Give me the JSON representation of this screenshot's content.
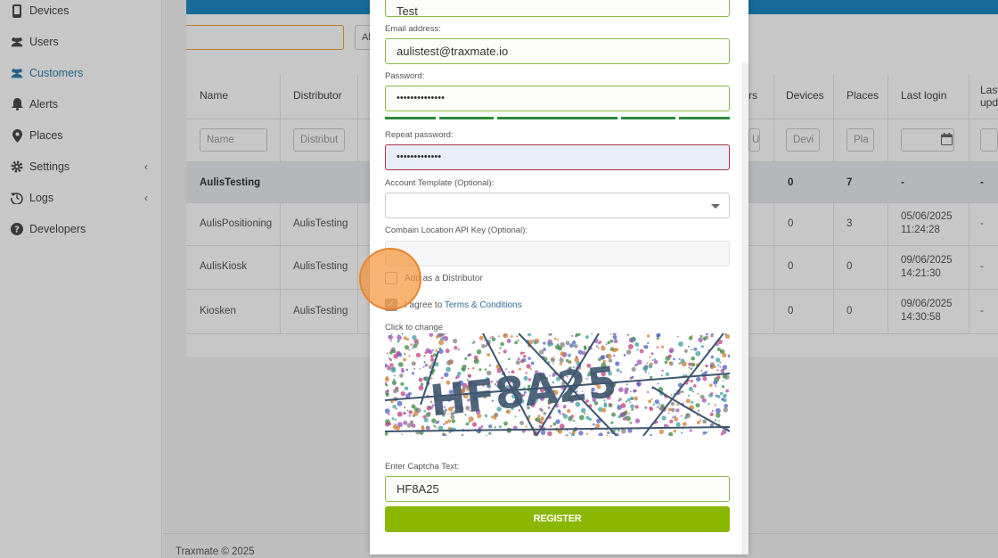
{
  "sidebar": {
    "items": [
      {
        "label": "Devices",
        "icon": "device-icon",
        "active": false
      },
      {
        "label": "Users",
        "icon": "users-icon",
        "active": false
      },
      {
        "label": "Customers",
        "icon": "customers-icon",
        "active": true
      },
      {
        "label": "Alerts",
        "icon": "bell-icon",
        "active": false
      },
      {
        "label": "Places",
        "icon": "map-pin-icon",
        "active": false
      },
      {
        "label": "Settings",
        "icon": "gear-icon",
        "active": false,
        "expandable": true
      },
      {
        "label": "Logs",
        "icon": "history-icon",
        "active": false,
        "expandable": true
      },
      {
        "label": "Developers",
        "icon": "question-icon",
        "active": false
      }
    ]
  },
  "toolbar": {
    "button_partial": "Al"
  },
  "table": {
    "headers": [
      "Name",
      "Distributor",
      "rs",
      "Devices",
      "Places",
      "Last login",
      "Last",
      "upd"
    ],
    "filters": {
      "name": "Name",
      "distributor": "Distribut",
      "users": "U",
      "devices": "Devi",
      "places": "Pla"
    },
    "rows": [
      {
        "name": "AulisTesting",
        "distributor": "",
        "devices": "0",
        "places": "7",
        "last_login": "-",
        "last_update": "-"
      },
      {
        "name": "AulisPositioning",
        "distributor": "AulisTesting",
        "devices": "0",
        "places": "3",
        "last_login": "05/06/2025",
        "last_login_time": "11:24:28",
        "last_update": "-"
      },
      {
        "name": "AulisKiosk",
        "distributor": "AulisTesting",
        "devices": "0",
        "places": "0",
        "last_login": "09/06/2025",
        "last_login_time": "14:21:30",
        "last_update": "-"
      },
      {
        "name": "Kiosken",
        "distributor": "AulisTesting",
        "devices": "0",
        "places": "0",
        "last_login": "09/06/2025",
        "last_login_time": "14:30:58",
        "last_update": "-"
      }
    ]
  },
  "footer": {
    "text": "Traxmate © 2025"
  },
  "modal": {
    "name_value": "Test",
    "email_label": "Email address:",
    "email_value": "aulistest@traxmate.io",
    "password_label": "Password:",
    "password_value": "••••••••••••••",
    "repeat_label": "Repeat password:",
    "repeat_value": "•••••••••••••",
    "template_label": "Account Template (Optional):",
    "template_value": "",
    "combain_label": "Combain Location API Key (Optional):",
    "combain_value": "",
    "distributor_label": "Add as a Distributor",
    "agree_prefix": "I agree to",
    "agree_link": "Terms & Conditions",
    "captcha_hint": "Click to change",
    "captcha_code": "HF8A25",
    "captcha_label": "Enter Captcha Text:",
    "captcha_value": "HF8A25",
    "register_label": "REGISTER"
  },
  "colors": {
    "accent": "#2e7fb0",
    "header_blue": "#1f88c4",
    "register_green": "#8ab800",
    "valid_border": "#8bb84a",
    "error_border": "#b0304a",
    "click_indicator": "#f5963c"
  }
}
